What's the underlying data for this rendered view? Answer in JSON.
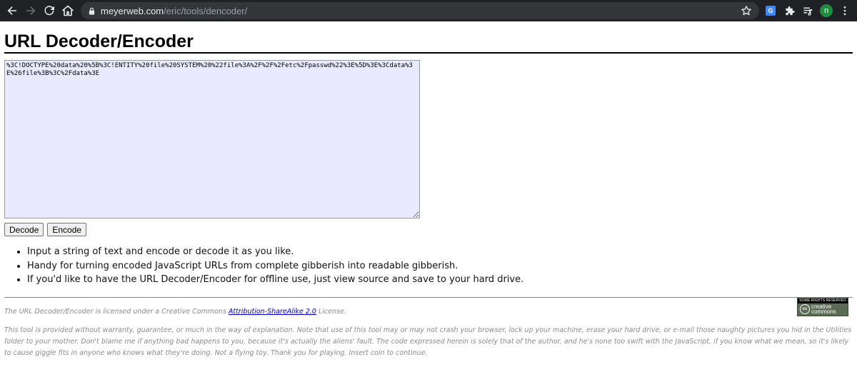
{
  "browser": {
    "url_host": "meyerweb.com",
    "url_path": "/eric/tools/dencoder/",
    "translate_label": "G",
    "profile_initial": "n"
  },
  "page": {
    "title": "URL Decoder/Encoder",
    "textarea_value": "%3C!DOCTYPE%20data%20%5B%3C!ENTITY%20file%20SYSTEM%20%22file%3A%2F%2F%2Fetc%2Fpasswd%22%3E%5D%3E%3Cdata%3E%26file%3B%3C%2Fdata%3E",
    "decode_label": "Decode",
    "encode_label": "Encode",
    "notes": [
      "Input a string of text and encode or decode it as you like.",
      "Handy for turning encoded JavaScript URLs from complete gibberish into readable gibberish.",
      "If you'd like to have the URL Decoder/Encoder for offline use, just view source and save to your hard drive."
    ]
  },
  "footer": {
    "license_prefix": "The URL Decoder/Encoder is licensed under a Creative Commons ",
    "license_link": "Attribution-ShareAlike 2.0",
    "license_suffix": " License.",
    "disclaimer": "This tool is provided without warranty, guarantee, or much in the way of explanation. Note that use of this tool may or may not crash your browser, lock up your machine, erase your hard drive, or e-mail those naughty pictures you hid in the Utilities folder to your mother. Don't blame me if anything bad happens to you, because it's actually the aliens' fault. The code expressed herein is solely that of the author, and he's none too swift with the JavaScript, if you know what we mean, so it's likely to cause giggle fits in anyone who knows what they're doing. Not a flying toy. Thank you for playing. Insert coin to continue.",
    "cc_badge_top": "SOME RIGHTS RESERVED",
    "cc_badge_symbol": "cc",
    "cc_badge_line1": "creative",
    "cc_badge_line2": "commons"
  },
  "colors": {
    "chrome_bg": "#202124",
    "textarea_bg": "#e9e9ff",
    "link": "#0000cc",
    "footer_text": "#8a8a8a"
  }
}
